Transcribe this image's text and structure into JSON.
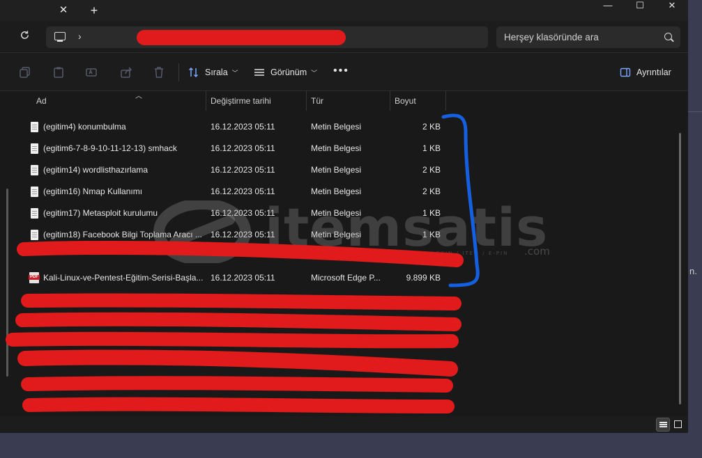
{
  "tabs": {
    "close_glyph": "✕",
    "new_glyph": "+"
  },
  "window_controls": {
    "minimize": "—",
    "maximize": "☐",
    "close": "✕"
  },
  "address": {
    "separator": "›"
  },
  "search": {
    "placeholder": "Herşey klasöründe ara"
  },
  "toolbar": {
    "sort_label": "Sırala",
    "view_label": "Görünüm",
    "more_label": "•••",
    "details_label": "Ayrıntılar"
  },
  "columns": {
    "name": "Ad",
    "date": "Değiştirme tarihi",
    "type": "Tür",
    "size": "Boyut"
  },
  "files": [
    {
      "name": "(egitim4) konumbulma",
      "date": "16.12.2023 05:11",
      "type": "Metin Belgesi",
      "size": "2 KB",
      "icon": "text-file-icon"
    },
    {
      "name": "(egitim6-7-8-9-10-11-12-13) smhack",
      "date": "16.12.2023 05:11",
      "type": "Metin Belgesi",
      "size": "1 KB",
      "icon": "text-file-icon"
    },
    {
      "name": "(egitim14) wordlisthazırlama",
      "date": "16.12.2023 05:11",
      "type": "Metin Belgesi",
      "size": "2 KB",
      "icon": "text-file-icon"
    },
    {
      "name": "(egitim16) Nmap Kullanımı",
      "date": "16.12.2023 05:11",
      "type": "Metin Belgesi",
      "size": "2 KB",
      "icon": "text-file-icon"
    },
    {
      "name": "(egitim17) Metasploit kurulumu",
      "date": "16.12.2023 05:11",
      "type": "Metin Belgesi",
      "size": "1 KB",
      "icon": "text-file-icon"
    },
    {
      "name": "(egitim18) Facebook Bilgi Toplama Aracı ...",
      "date": "16.12.2023 05:11",
      "type": "Metin Belgesi",
      "size": "1 KB",
      "icon": "text-file-icon"
    },
    {
      "name": "",
      "date": "",
      "type": "",
      "size": "",
      "icon": "redacted"
    },
    {
      "name": "Kali-Linux-ve-Pentest-Eğitim-Serisi-Başla...",
      "date": "16.12.2023 05:11",
      "type": "Microsoft Edge P...",
      "size": "9.899 KB",
      "icon": "pdf-file-icon"
    }
  ],
  "watermark": {
    "text": "itemsatis",
    "domain": ".com",
    "tagline": "HESAP / SKIN / ITEM / E-PIN"
  },
  "side": {
    "text": "n."
  },
  "colors": {
    "redaction": "#e11b1b",
    "bracket": "#1560e0",
    "background": "#191919"
  }
}
